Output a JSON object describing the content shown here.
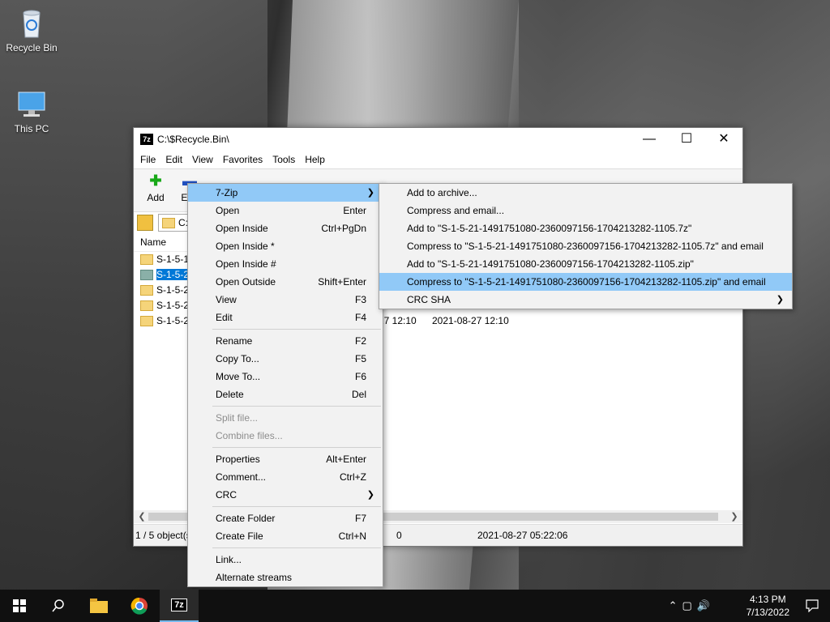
{
  "desktop": {
    "icons": [
      {
        "label": "Recycle Bin",
        "icon": "recycle-bin-icon"
      },
      {
        "label": "This PC",
        "icon": "computer-icon"
      }
    ]
  },
  "window": {
    "title": "C:\\$Recycle.Bin\\",
    "menu": [
      "File",
      "Edit",
      "View",
      "Favorites",
      "Tools",
      "Help"
    ],
    "toolbar": [
      "Add",
      "Extr"
    ],
    "address": "C:",
    "column_name": "Name",
    "files": [
      {
        "name": "S-1-5-18"
      },
      {
        "name": "S-1-5-21",
        "selected": true
      },
      {
        "name": "S-1-5-21"
      },
      {
        "name": "S-1-5-21"
      },
      {
        "name": "S-1-5-21",
        "modified": "-27 12:10",
        "created": "2021-08-27 12:10"
      }
    ],
    "status": {
      "objects": "1 / 5 object(s",
      "size": "0",
      "date": "2021-08-27 05:22:06"
    }
  },
  "context_menu": {
    "items": [
      {
        "label": "7-Zip",
        "shortcut": "",
        "submenu": true,
        "highlight": true
      },
      {
        "label": "Open",
        "shortcut": "Enter"
      },
      {
        "label": "Open Inside",
        "shortcut": "Ctrl+PgDn"
      },
      {
        "label": "Open Inside *",
        "shortcut": ""
      },
      {
        "label": "Open Inside #",
        "shortcut": ""
      },
      {
        "label": "Open Outside",
        "shortcut": "Shift+Enter"
      },
      {
        "label": "View",
        "shortcut": "F3"
      },
      {
        "label": "Edit",
        "shortcut": "F4"
      },
      {
        "sep": true
      },
      {
        "label": "Rename",
        "shortcut": "F2"
      },
      {
        "label": "Copy To...",
        "shortcut": "F5"
      },
      {
        "label": "Move To...",
        "shortcut": "F6"
      },
      {
        "label": "Delete",
        "shortcut": "Del"
      },
      {
        "sep": true
      },
      {
        "label": "Split file...",
        "shortcut": "",
        "disabled": true
      },
      {
        "label": "Combine files...",
        "shortcut": "",
        "disabled": true
      },
      {
        "sep": true
      },
      {
        "label": "Properties",
        "shortcut": "Alt+Enter"
      },
      {
        "label": "Comment...",
        "shortcut": "Ctrl+Z"
      },
      {
        "label": "CRC",
        "shortcut": "",
        "submenu": true
      },
      {
        "sep": true
      },
      {
        "label": "Create Folder",
        "shortcut": "F7"
      },
      {
        "label": "Create File",
        "shortcut": "Ctrl+N"
      },
      {
        "sep": true
      },
      {
        "label": "Link...",
        "shortcut": ""
      },
      {
        "label": "Alternate streams",
        "shortcut": ""
      }
    ]
  },
  "submenu": {
    "items": [
      {
        "label": "Add to archive..."
      },
      {
        "label": "Compress and email..."
      },
      {
        "label": "Add to \"S-1-5-21-1491751080-2360097156-1704213282-1105.7z\""
      },
      {
        "label": "Compress to \"S-1-5-21-1491751080-2360097156-1704213282-1105.7z\" and email"
      },
      {
        "label": "Add to \"S-1-5-21-1491751080-2360097156-1704213282-1105.zip\""
      },
      {
        "label": "Compress to \"S-1-5-21-1491751080-2360097156-1704213282-1105.zip\" and email",
        "highlight": true
      },
      {
        "label": "CRC SHA",
        "submenu": true
      }
    ]
  },
  "taskbar": {
    "time": "4:13 PM",
    "date": "7/13/2022",
    "app_label": "7z"
  }
}
